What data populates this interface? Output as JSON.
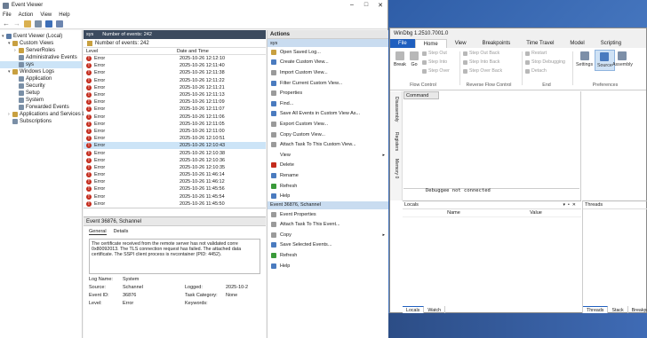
{
  "event_viewer": {
    "title": "Event Viewer",
    "menu": [
      "File",
      "Action",
      "View",
      "Help"
    ],
    "tree": [
      {
        "label": "Event Viewer (Local)",
        "indent": 0,
        "arrow": "▾",
        "color": "#5a7ba6"
      },
      {
        "label": "Custom Views",
        "indent": 1,
        "arrow": "▾",
        "color": "#c8a040"
      },
      {
        "label": "ServerRoles",
        "indent": 2,
        "arrow": "›",
        "color": "#c8a040"
      },
      {
        "label": "Administrative Events",
        "indent": 2,
        "arrow": "",
        "color": "#7a8fa6"
      },
      {
        "label": "sys",
        "indent": 2,
        "arrow": "",
        "color": "#7a8fa6",
        "selected": true
      },
      {
        "label": "Windows Logs",
        "indent": 1,
        "arrow": "▾",
        "color": "#c8a040"
      },
      {
        "label": "Application",
        "indent": 2,
        "arrow": "",
        "color": "#7a8fa6"
      },
      {
        "label": "Security",
        "indent": 2,
        "arrow": "",
        "color": "#7a8fa6"
      },
      {
        "label": "Setup",
        "indent": 2,
        "arrow": "",
        "color": "#7a8fa6"
      },
      {
        "label": "System",
        "indent": 2,
        "arrow": "",
        "color": "#7a8fa6"
      },
      {
        "label": "Forwarded Events",
        "indent": 2,
        "arrow": "",
        "color": "#7a8fa6"
      },
      {
        "label": "Applications and Services Lo",
        "indent": 1,
        "arrow": "›",
        "color": "#c8a040"
      },
      {
        "label": "Subscriptions",
        "indent": 1,
        "arrow": "",
        "color": "#7a8fa6"
      }
    ],
    "center_header": {
      "name": "sys",
      "count": "Number of events: 242"
    },
    "list_header": "Number of events: 242",
    "columns": [
      "Level",
      "Date and Time"
    ],
    "rows": [
      {
        "level": "Error",
        "time": "2025-10-26 12:12:10"
      },
      {
        "level": "Error",
        "time": "2025-10-26 12:11:40"
      },
      {
        "level": "Error",
        "time": "2025-10-26 12:11:38"
      },
      {
        "level": "Error",
        "time": "2025-10-26 12:11:22"
      },
      {
        "level": "Error",
        "time": "2025-10-26 12:11:21"
      },
      {
        "level": "Error",
        "time": "2025-10-26 12:11:13"
      },
      {
        "level": "Error",
        "time": "2025-10-26 12:11:09"
      },
      {
        "level": "Error",
        "time": "2025-10-26 12:11:07"
      },
      {
        "level": "Error",
        "time": "2025-10-26 12:11:06"
      },
      {
        "level": "Error",
        "time": "2025-10-26 12:11:05"
      },
      {
        "level": "Error",
        "time": "2025-10-26 12:11:00"
      },
      {
        "level": "Error",
        "time": "2025-10-26 12:10:51"
      },
      {
        "level": "Error",
        "time": "2025-10-26 12:10:43",
        "selected": true
      },
      {
        "level": "Error",
        "time": "2025-10-26 12:10:38"
      },
      {
        "level": "Error",
        "time": "2025-10-26 12:10:36"
      },
      {
        "level": "Error",
        "time": "2025-10-26 12:10:35"
      },
      {
        "level": "Error",
        "time": "2025-10-26 11:46:14"
      },
      {
        "level": "Error",
        "time": "2025-10-26 11:46:12"
      },
      {
        "level": "Error",
        "time": "2025-10-26 11:45:56"
      },
      {
        "level": "Error",
        "time": "2025-10-26 11:45:54"
      },
      {
        "level": "Error",
        "time": "2025-10-26 11:45:50"
      }
    ],
    "detail": {
      "title": "Event 36876, Schannel",
      "tabs": [
        "General",
        "Details"
      ],
      "message": "The certificate received from the remote server has not validated corre 0x80092013. The TLS connection request has failed. The attached data certificate. The SSPI client process is nvcontainer (PID: 4452).",
      "props": [
        {
          "k": "Log Name:",
          "v": "System",
          "k2": "",
          "v2": ""
        },
        {
          "k": "Source:",
          "v": "Schannel",
          "k2": "Logged:",
          "v2": "2025-10-2"
        },
        {
          "k": "Event ID:",
          "v": "36876",
          "k2": "Task Category:",
          "v2": "None"
        },
        {
          "k": "Level:",
          "v": "Error",
          "k2": "Keywords:",
          "v2": ""
        }
      ]
    },
    "actions": {
      "header": "Actions",
      "section1": "sys",
      "items1": [
        {
          "label": "Open Saved Log...",
          "color": "#c8a040"
        },
        {
          "label": "Create Custom View...",
          "color": "#4a7bbf"
        },
        {
          "label": "Import Custom View...",
          "color": "#9a9a9a"
        },
        {
          "label": "Filter Current Custom View...",
          "color": "#4a7bbf"
        },
        {
          "label": "Properties",
          "color": "#9a9a9a"
        },
        {
          "label": "Find...",
          "color": "#4a7bbf"
        },
        {
          "label": "Save All Events in Custom View As...",
          "color": "#4a7bbf"
        },
        {
          "label": "Export Custom View...",
          "color": "#9a9a9a"
        },
        {
          "label": "Copy Custom View...",
          "color": "#9a9a9a"
        },
        {
          "label": "Attach Task To This Custom View...",
          "color": "#9a9a9a"
        },
        {
          "label": "View",
          "color": "#ffffff",
          "arrow": "▸"
        },
        {
          "label": "Delete",
          "color": "#c42b1c"
        },
        {
          "label": "Rename",
          "color": "#4a7bbf"
        },
        {
          "label": "Refresh",
          "color": "#3a9a3a"
        },
        {
          "label": "Help",
          "color": "#4a7bbf"
        }
      ],
      "section2": "Event 36876, Schannel",
      "items2": [
        {
          "label": "Event Properties",
          "color": "#9a9a9a"
        },
        {
          "label": "Attach Task To This Event...",
          "color": "#9a9a9a"
        },
        {
          "label": "Copy",
          "color": "#9a9a9a",
          "arrow": "▸"
        },
        {
          "label": "Save Selected Events...",
          "color": "#4a7bbf"
        },
        {
          "label": "Refresh",
          "color": "#3a9a3a"
        },
        {
          "label": "Help",
          "color": "#4a7bbf"
        }
      ]
    }
  },
  "windbg": {
    "title": "WinDbg 1.2510.7001.0",
    "tabs": [
      "File",
      "Home",
      "View",
      "Breakpoints",
      "Time Travel",
      "Model",
      "Scripting"
    ],
    "ribbon": {
      "break": "Break",
      "go": "Go",
      "step_into": "Step Into",
      "step_out": "Step Out",
      "step_over": "Step Over",
      "step_out_back": "Step Out Back",
      "step_into_back": "Step Into Back",
      "step_over_back": "Step Over Back",
      "restart": "Restart",
      "stop_debugging": "Stop Debugging",
      "detach": "Detach",
      "settings": "Settings",
      "source": "Source",
      "assembly": "Assembly",
      "group_flow": "Flow Control",
      "group_reverse": "Reverse Flow Control",
      "group_end": "End",
      "group_prefs": "Preferences"
    },
    "command_tab": "Command",
    "side_tabs": [
      "Disassembly",
      "Registers",
      "Memory 0"
    ],
    "output": "Debuggee not connected",
    "locals": {
      "title": "Locals",
      "cols": [
        "Name",
        "Value"
      ],
      "tabs": [
        "Locals",
        "Watch"
      ]
    },
    "threads": {
      "title": "Threads",
      "tabs": [
        "Threads",
        "Stack",
        "Breakpo"
      ]
    }
  },
  "watermark": "skelbimai.lt"
}
